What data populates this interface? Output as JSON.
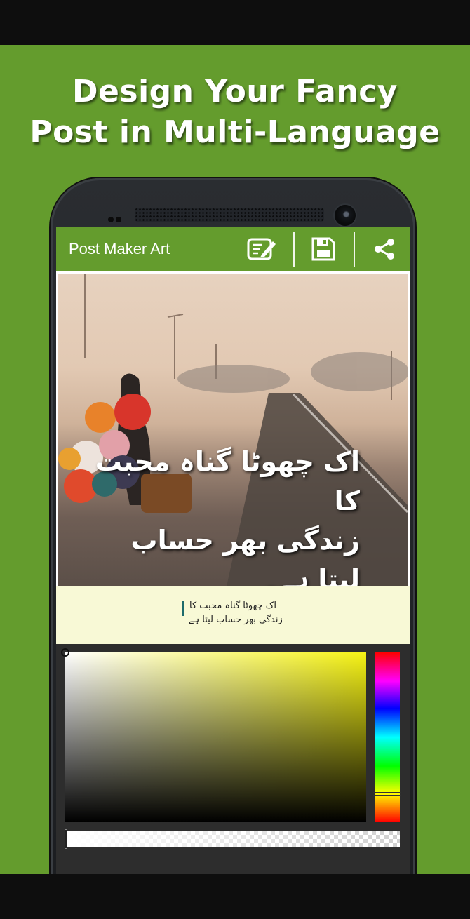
{
  "promo": {
    "headline_line1": "Design Your Fancy",
    "headline_line2": "Post in Multi-Language",
    "background_color": "#649c2d"
  },
  "app": {
    "title": "Post Maker Art",
    "toolbar_icons": [
      "edit-icon",
      "save-icon",
      "share-icon"
    ]
  },
  "post": {
    "overlay_line1": "اک چھوٹا گناہ محبت کا",
    "overlay_line2": "زندگی بھر حساب لیتا ہے۔"
  },
  "editor": {
    "line1": "اک چھوٹا گناہ محبت کا",
    "line2": "زندگی بھر حساب لیتا ہے۔"
  },
  "color_picker": {
    "selected_hue_color": "#f5f214",
    "saturation": 0,
    "value": 1,
    "alpha": 1
  }
}
